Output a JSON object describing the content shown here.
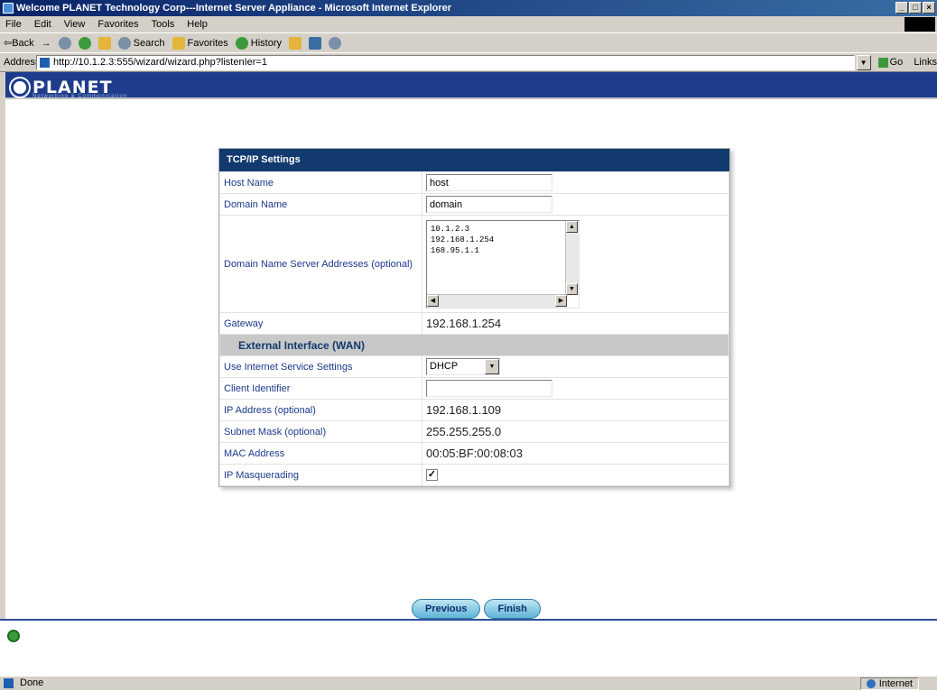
{
  "window": {
    "title": "Welcome PLANET Technology Corp---Internet Server Appliance - Microsoft Internet Explorer",
    "buttons": [
      "_",
      "□",
      "×"
    ]
  },
  "menu": [
    "File",
    "Edit",
    "View",
    "Favorites",
    "Tools",
    "Help"
  ],
  "toolbar": {
    "back": "⇦Back",
    "forward": "→",
    "search": "Search",
    "favorites": "Favorites",
    "history": "History"
  },
  "address": {
    "label": "Address",
    "url": "http://10.1.2.3:555/wizard/wizard.php?listenIer=1",
    "go": "Go",
    "links": "Links"
  },
  "brand": {
    "logo": "PLANET",
    "tagline": "Networking & Communication"
  },
  "panel": {
    "title": "TCP/IP Settings",
    "host_name": {
      "label": "Host Name",
      "value": "host"
    },
    "domain_name": {
      "label": "Domain Name",
      "value": "domain"
    },
    "dns": {
      "label": "Domain Name Server Addresses (optional)",
      "lines": [
        "10.1.2.3",
        "192.168.1.254",
        "168.95.1.1"
      ]
    },
    "gateway": {
      "label": "Gateway",
      "value": "192.168.1.254"
    },
    "wan_section": "External Interface (WAN)",
    "isp_settings": {
      "label": "Use Internet Service Settings",
      "value": "DHCP"
    },
    "client_id": {
      "label": "Client Identifier",
      "value": ""
    },
    "ip_address": {
      "label": "IP Address (optional)",
      "value": "192.168.1.109"
    },
    "subnet_mask": {
      "label": "Subnet Mask (optional)",
      "value": "255.255.255.0"
    },
    "mac_address": {
      "label": "MAC Address",
      "value": "00:05:BF:00:08:03"
    },
    "ip_masq": {
      "label": "IP Masquerading",
      "checked": "✓"
    }
  },
  "buttons": {
    "previous": "Previous",
    "finish": "Finish"
  },
  "status": {
    "text": "Done",
    "zone": "Internet"
  }
}
